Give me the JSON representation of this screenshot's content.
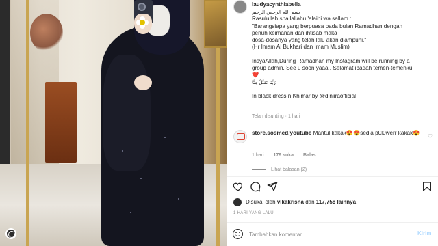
{
  "post": {
    "username": "laudyacynthiabella",
    "caption_lines": [
      "بسم الله الرحمن الرحيم",
      "Rasulullah shallallahu 'alaihi wa sallam :",
      "\"Barangsiapa yang berpuasa pada bulan Ramadhan dengan",
      "penuh keimanan dan ihtisab maka",
      "dosa-dosanya yang telah lalu akan diampuni.\"",
      "(Hr Imam Al Bukhari dan Imam Muslim)",
      "",
      "InsyaAllah,During Ramadhan my Instagram will be running by a",
      "group admin. See u soon yaaa.. Selamat ibadah temen-temenku",
      "❤️",
      "رَبَّنَا تَقَبَّلْ مِنَّا",
      "",
      "In black dress n Khimar by @diniiraofficial"
    ],
    "meta_translation": "Telah disunting",
    "meta_time": "1 hari"
  },
  "comment": {
    "username": "store.sosmed.youtube",
    "text": "Mantul kakak😍😍sedia p0l0werr kakak😍",
    "time": "1 hari",
    "likes": "179 suka",
    "reply": "Balas",
    "view_replies": "Lihat balasan (2)"
  },
  "actions": {
    "like_icon": "heart-icon",
    "comment_icon": "comment-icon",
    "share_icon": "share-icon",
    "save_icon": "bookmark-icon"
  },
  "likes": {
    "prefix": "Disukai oleh",
    "user": "vikakrisna",
    "connector": "dan",
    "count": "117,758",
    "suffix": "lainnya"
  },
  "date": "1 HARI YANG LALU",
  "comment_box": {
    "placeholder": "Tambahkan komentar...",
    "post_label": "Kirim"
  },
  "colors": {
    "link": "#00376b",
    "post_button": "#b3dbff",
    "muted": "#8e8e8e"
  }
}
